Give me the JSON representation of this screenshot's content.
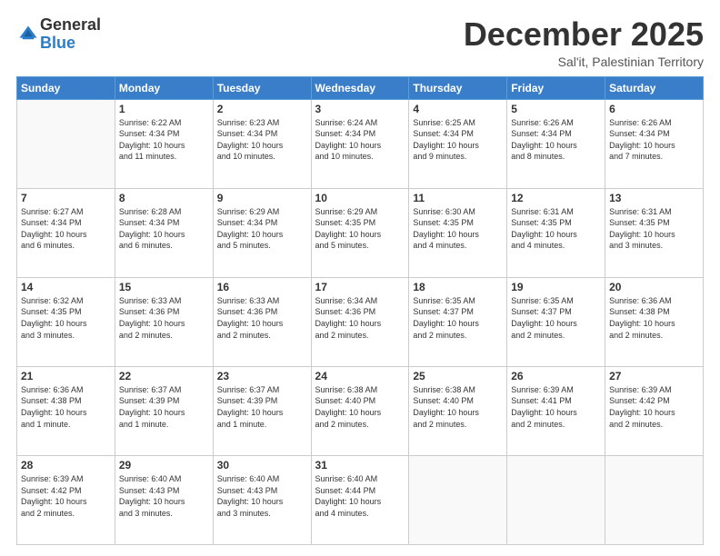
{
  "logo": {
    "general": "General",
    "blue": "Blue"
  },
  "header": {
    "month": "December 2025",
    "location": "Sal'it, Palestinian Territory"
  },
  "days_of_week": [
    "Sunday",
    "Monday",
    "Tuesday",
    "Wednesday",
    "Thursday",
    "Friday",
    "Saturday"
  ],
  "weeks": [
    [
      {
        "day": "",
        "info": ""
      },
      {
        "day": "1",
        "info": "Sunrise: 6:22 AM\nSunset: 4:34 PM\nDaylight: 10 hours\nand 11 minutes."
      },
      {
        "day": "2",
        "info": "Sunrise: 6:23 AM\nSunset: 4:34 PM\nDaylight: 10 hours\nand 10 minutes."
      },
      {
        "day": "3",
        "info": "Sunrise: 6:24 AM\nSunset: 4:34 PM\nDaylight: 10 hours\nand 10 minutes."
      },
      {
        "day": "4",
        "info": "Sunrise: 6:25 AM\nSunset: 4:34 PM\nDaylight: 10 hours\nand 9 minutes."
      },
      {
        "day": "5",
        "info": "Sunrise: 6:26 AM\nSunset: 4:34 PM\nDaylight: 10 hours\nand 8 minutes."
      },
      {
        "day": "6",
        "info": "Sunrise: 6:26 AM\nSunset: 4:34 PM\nDaylight: 10 hours\nand 7 minutes."
      }
    ],
    [
      {
        "day": "7",
        "info": "Sunrise: 6:27 AM\nSunset: 4:34 PM\nDaylight: 10 hours\nand 6 minutes."
      },
      {
        "day": "8",
        "info": "Sunrise: 6:28 AM\nSunset: 4:34 PM\nDaylight: 10 hours\nand 6 minutes."
      },
      {
        "day": "9",
        "info": "Sunrise: 6:29 AM\nSunset: 4:34 PM\nDaylight: 10 hours\nand 5 minutes."
      },
      {
        "day": "10",
        "info": "Sunrise: 6:29 AM\nSunset: 4:35 PM\nDaylight: 10 hours\nand 5 minutes."
      },
      {
        "day": "11",
        "info": "Sunrise: 6:30 AM\nSunset: 4:35 PM\nDaylight: 10 hours\nand 4 minutes."
      },
      {
        "day": "12",
        "info": "Sunrise: 6:31 AM\nSunset: 4:35 PM\nDaylight: 10 hours\nand 4 minutes."
      },
      {
        "day": "13",
        "info": "Sunrise: 6:31 AM\nSunset: 4:35 PM\nDaylight: 10 hours\nand 3 minutes."
      }
    ],
    [
      {
        "day": "14",
        "info": "Sunrise: 6:32 AM\nSunset: 4:35 PM\nDaylight: 10 hours\nand 3 minutes."
      },
      {
        "day": "15",
        "info": "Sunrise: 6:33 AM\nSunset: 4:36 PM\nDaylight: 10 hours\nand 2 minutes."
      },
      {
        "day": "16",
        "info": "Sunrise: 6:33 AM\nSunset: 4:36 PM\nDaylight: 10 hours\nand 2 minutes."
      },
      {
        "day": "17",
        "info": "Sunrise: 6:34 AM\nSunset: 4:36 PM\nDaylight: 10 hours\nand 2 minutes."
      },
      {
        "day": "18",
        "info": "Sunrise: 6:35 AM\nSunset: 4:37 PM\nDaylight: 10 hours\nand 2 minutes."
      },
      {
        "day": "19",
        "info": "Sunrise: 6:35 AM\nSunset: 4:37 PM\nDaylight: 10 hours\nand 2 minutes."
      },
      {
        "day": "20",
        "info": "Sunrise: 6:36 AM\nSunset: 4:38 PM\nDaylight: 10 hours\nand 2 minutes."
      }
    ],
    [
      {
        "day": "21",
        "info": "Sunrise: 6:36 AM\nSunset: 4:38 PM\nDaylight: 10 hours\nand 1 minute."
      },
      {
        "day": "22",
        "info": "Sunrise: 6:37 AM\nSunset: 4:39 PM\nDaylight: 10 hours\nand 1 minute."
      },
      {
        "day": "23",
        "info": "Sunrise: 6:37 AM\nSunset: 4:39 PM\nDaylight: 10 hours\nand 1 minute."
      },
      {
        "day": "24",
        "info": "Sunrise: 6:38 AM\nSunset: 4:40 PM\nDaylight: 10 hours\nand 2 minutes."
      },
      {
        "day": "25",
        "info": "Sunrise: 6:38 AM\nSunset: 4:40 PM\nDaylight: 10 hours\nand 2 minutes."
      },
      {
        "day": "26",
        "info": "Sunrise: 6:39 AM\nSunset: 4:41 PM\nDaylight: 10 hours\nand 2 minutes."
      },
      {
        "day": "27",
        "info": "Sunrise: 6:39 AM\nSunset: 4:42 PM\nDaylight: 10 hours\nand 2 minutes."
      }
    ],
    [
      {
        "day": "28",
        "info": "Sunrise: 6:39 AM\nSunset: 4:42 PM\nDaylight: 10 hours\nand 2 minutes."
      },
      {
        "day": "29",
        "info": "Sunrise: 6:40 AM\nSunset: 4:43 PM\nDaylight: 10 hours\nand 3 minutes."
      },
      {
        "day": "30",
        "info": "Sunrise: 6:40 AM\nSunset: 4:43 PM\nDaylight: 10 hours\nand 3 minutes."
      },
      {
        "day": "31",
        "info": "Sunrise: 6:40 AM\nSunset: 4:44 PM\nDaylight: 10 hours\nand 4 minutes."
      },
      {
        "day": "",
        "info": ""
      },
      {
        "day": "",
        "info": ""
      },
      {
        "day": "",
        "info": ""
      }
    ]
  ]
}
